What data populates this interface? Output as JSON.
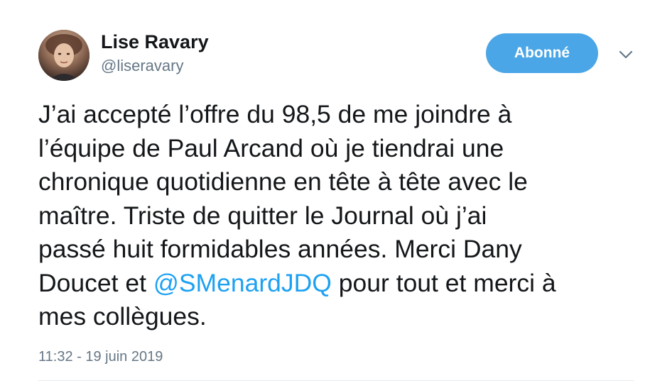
{
  "author": {
    "name": "Lise Ravary",
    "handle": "@liseravary"
  },
  "follow_button": {
    "label": "Abonné",
    "color": "#4aa6e6"
  },
  "menu": {
    "icon": "chevron-down-icon"
  },
  "tweet": {
    "line1": "J’ai accepté l’offre du 98,5 de me joindre à",
    "line2": "l’équipe de Paul Arcand où je tiendrai une",
    "line3": "chronique quotidienne en tête à tête avec le",
    "line4": "maître. Triste de quitter le Journal où j’ai",
    "line5": "passé huit formidables années. Merci Dany",
    "line6_before": "Doucet et ",
    "mention": "@SMenardJDQ",
    "line6_after": " pour tout et merci à",
    "line7": "mes collègues.",
    "mention_color": "#1da1f2"
  },
  "timestamp": "11:32 - 19 juin 2019"
}
